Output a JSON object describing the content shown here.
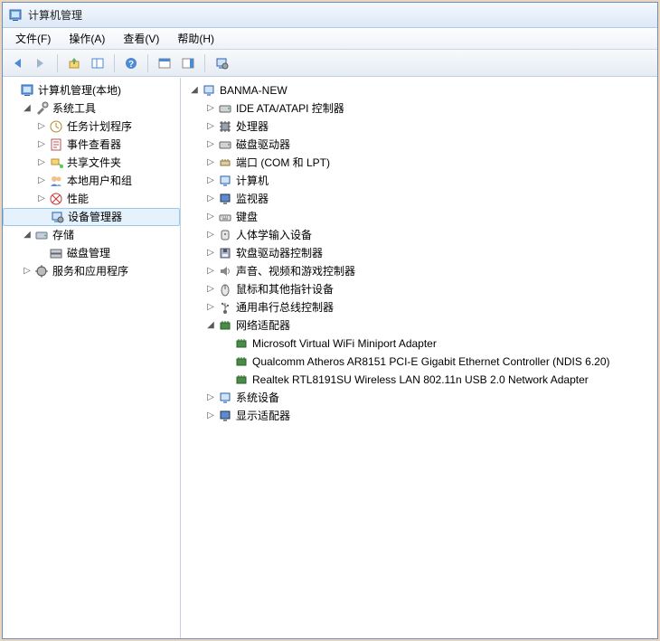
{
  "window": {
    "title": "计算机管理"
  },
  "menu": {
    "file": "文件(F)",
    "action": "操作(A)",
    "view": "查看(V)",
    "help": "帮助(H)"
  },
  "left_tree": {
    "root": {
      "label": "计算机管理(本地)",
      "expanded": true
    },
    "system_tools": {
      "label": "系统工具",
      "expanded": true
    },
    "task_scheduler": "任务计划程序",
    "event_viewer": "事件查看器",
    "shared_folders": "共享文件夹",
    "local_users": "本地用户和组",
    "performance": "性能",
    "device_manager": "设备管理器",
    "storage": {
      "label": "存储",
      "expanded": true
    },
    "disk_mgmt": "磁盘管理",
    "services_apps": "服务和应用程序"
  },
  "right_tree": {
    "root": "BANMA-NEW",
    "ide": "IDE ATA/ATAPI 控制器",
    "processors": "处理器",
    "disk_drives": "磁盘驱动器",
    "ports": "端口 (COM 和 LPT)",
    "computer": "计算机",
    "monitors": "监视器",
    "keyboards": "键盘",
    "hid": "人体学输入设备",
    "floppy_ctrl": "软盘驱动器控制器",
    "sound": "声音、视频和游戏控制器",
    "mice": "鼠标和其他指针设备",
    "usb": "通用串行总线控制器",
    "network": "网络适配器",
    "net0": "Microsoft Virtual WiFi Miniport Adapter",
    "net1": "Qualcomm Atheros AR8151 PCI-E Gigabit Ethernet Controller (NDIS 6.20)",
    "net2": "Realtek RTL8191SU Wireless LAN 802.11n USB 2.0 Network Adapter",
    "system_devices": "系统设备",
    "display": "显示适配器"
  }
}
